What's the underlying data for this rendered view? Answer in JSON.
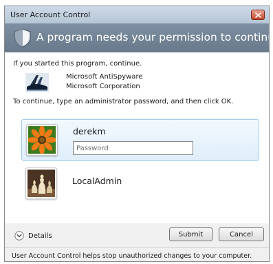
{
  "window": {
    "title": "User Account Control"
  },
  "header": {
    "text": "A program needs your permission to continue"
  },
  "content": {
    "intro": "If you started this program, continue.",
    "program": {
      "name": "Microsoft AntiSpyware",
      "publisher": "Microsoft Corporation"
    },
    "instructions": "To continue, type an administrator password, and then click OK."
  },
  "accounts": [
    {
      "username": "derekm",
      "password_placeholder": "Password",
      "password_value": "",
      "avatar": "orange-flower-avatar"
    },
    {
      "username": "LocalAdmin",
      "avatar": "chess-pieces-avatar"
    }
  ],
  "footer": {
    "details_label": "Details",
    "submit_label": "Submit",
    "cancel_label": "Cancel",
    "info_text": "User Account Control helps stop unauthorized changes to your computer."
  },
  "colors": {
    "header_bg": "#6e7f91",
    "selected_tile_border": "#9ccbee",
    "close_button": "#c4482f"
  }
}
